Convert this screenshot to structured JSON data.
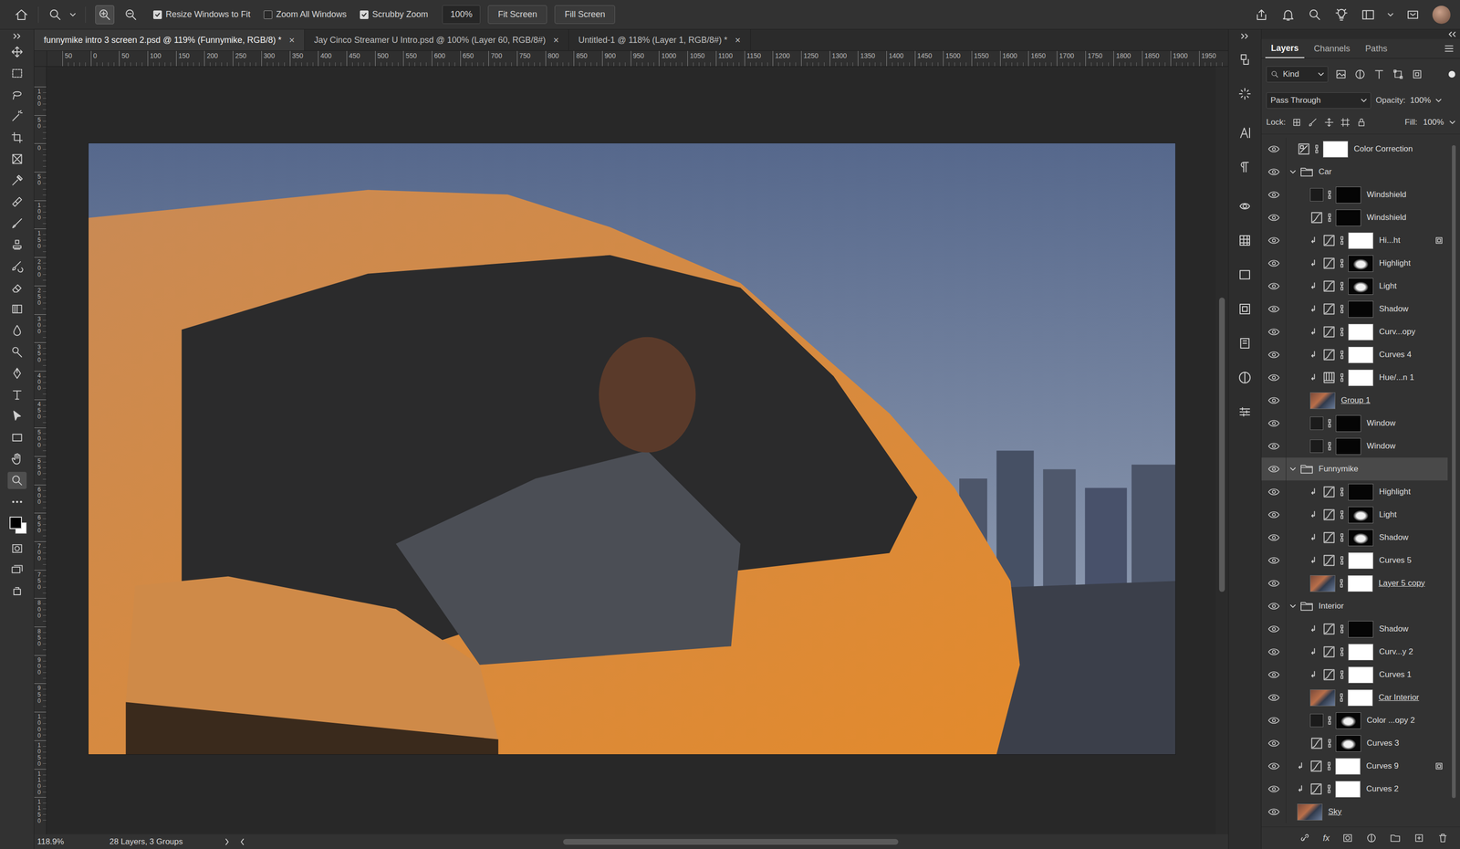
{
  "options_bar": {
    "checkboxes": [
      {
        "label": "Resize Windows to Fit",
        "checked": true
      },
      {
        "label": "Zoom All Windows",
        "checked": false
      },
      {
        "label": "Scrubby Zoom",
        "checked": true
      }
    ],
    "zoom_field": "100%",
    "buttons": [
      "Fit Screen",
      "Fill Screen"
    ]
  },
  "document_tabs": {
    "close": "×",
    "items": [
      {
        "label": "funnymike intro 3 screen 2.psd @ 119% (Funnymike, RGB/8) *",
        "selected": true
      },
      {
        "label": "Jay Cinco Streamer U Intro.psd @ 100% (Layer 60, RGB/8#)",
        "selected": false
      },
      {
        "label": "Untitled-1 @ 118% (Layer 1, RGB/8#) *",
        "selected": false
      }
    ]
  },
  "toolbar": {
    "tools": [
      {
        "kind": "move",
        "selected": false
      },
      {
        "kind": "marquee",
        "selected": false
      },
      {
        "kind": "lasso",
        "selected": false
      },
      {
        "kind": "wand",
        "selected": false
      },
      {
        "kind": "crop",
        "selected": false
      },
      {
        "kind": "frame",
        "selected": false
      },
      {
        "kind": "eyedropper",
        "selected": false
      },
      {
        "kind": "healing",
        "selected": false
      },
      {
        "kind": "brush",
        "selected": false
      },
      {
        "kind": "stamp",
        "selected": false
      },
      {
        "kind": "history",
        "selected": false
      },
      {
        "kind": "eraser",
        "selected": false
      },
      {
        "kind": "gradient",
        "selected": false
      },
      {
        "kind": "blur",
        "selected": false
      },
      {
        "kind": "dodge",
        "selected": false
      },
      {
        "kind": "pen",
        "selected": false
      },
      {
        "kind": "type",
        "selected": false
      },
      {
        "kind": "select",
        "selected": false
      },
      {
        "kind": "shape",
        "selected": false
      },
      {
        "kind": "hand",
        "selected": false
      },
      {
        "kind": "zoom",
        "selected": true
      },
      {
        "kind": "more",
        "selected": false
      },
      {
        "kind": "colors",
        "selected": false
      },
      {
        "kind": "quickmask",
        "selected": false
      },
      {
        "kind": "screen",
        "selected": false
      },
      {
        "kind": "extra",
        "selected": false
      }
    ]
  },
  "rulers": {
    "top": [
      "50",
      "0",
      "50",
      "100",
      "150",
      "200",
      "250",
      "300",
      "350",
      "400",
      "450",
      "500",
      "550",
      "600",
      "650",
      "700",
      "750",
      "800",
      "850",
      "900",
      "950",
      "1000",
      "1050",
      "1100",
      "1150",
      "1200",
      "1250",
      "1300",
      "1350",
      "1400",
      "1450",
      "1500",
      "1550",
      "1600",
      "1650",
      "1700",
      "1750",
      "1800",
      "1850",
      "1900",
      "1950"
    ],
    "left": [
      "100",
      "50",
      "0",
      "50",
      "100",
      "150",
      "200",
      "250",
      "300",
      "350",
      "400",
      "450",
      "500",
      "550",
      "600",
      "650",
      "700",
      "750",
      "800",
      "850",
      "900",
      "950",
      "1000",
      "1050",
      "1100",
      "1150"
    ]
  },
  "scrollbars": {
    "vertical": {
      "offset": 0.3,
      "size": 0.385
    },
    "horizontal": {
      "offset": 0.32,
      "size": 0.35
    },
    "layers": {
      "offset": 0.01,
      "size": 0.95
    }
  },
  "layers_panel": {
    "tabs": [
      {
        "label": "Layers",
        "selected": true
      },
      {
        "label": "Channels",
        "selected": false
      },
      {
        "label": "Paths",
        "selected": false
      }
    ],
    "filter": "Kind",
    "blend_mode": "Pass Through",
    "opacity_label": "Opacity:",
    "opacity": "100%",
    "lock_label": "Lock:",
    "fill_label": "Fill:",
    "fill": "100%",
    "footer_fx": "fx",
    "layers": [
      {
        "name": "Color Correction",
        "kind": "lookup",
        "indent": 0,
        "clip": false,
        "mask": "light",
        "clip_base": false,
        "badge": false,
        "visible": true,
        "selected": false
      },
      {
        "name": "Car",
        "kind": "group",
        "indent": 0,
        "clip": false,
        "mask": "none",
        "clip_base": false,
        "badge": false,
        "visible": true,
        "selected": false,
        "expanded": true
      },
      {
        "name": "Windshield",
        "kind": "fill",
        "indent": 1,
        "clip": false,
        "mask": "dark",
        "clip_base": false,
        "badge": false,
        "visible": true,
        "selected": false
      },
      {
        "name": "Windshield",
        "kind": "adjustment",
        "indent": 1,
        "clip": false,
        "mask": "dark",
        "clip_base": false,
        "badge": false,
        "visible": true,
        "selected": false
      },
      {
        "name": "Hi...ht",
        "kind": "adjustment",
        "indent": 1,
        "clip": true,
        "mask": "light",
        "clip_base": false,
        "badge": true,
        "visible": true,
        "selected": false
      },
      {
        "name": "Highlight",
        "kind": "adjustment",
        "indent": 1,
        "clip": true,
        "mask": "mixed",
        "clip_base": false,
        "badge": false,
        "visible": true,
        "selected": false
      },
      {
        "name": "Light",
        "kind": "adjustment",
        "indent": 1,
        "clip": true,
        "mask": "mixed",
        "clip_base": false,
        "badge": false,
        "visible": true,
        "selected": false
      },
      {
        "name": "Shadow",
        "kind": "adjustment",
        "indent": 1,
        "clip": true,
        "mask": "dark",
        "clip_base": false,
        "badge": false,
        "visible": true,
        "selected": false
      },
      {
        "name": "Curv...opy",
        "kind": "adjustment",
        "indent": 1,
        "clip": true,
        "mask": "light",
        "clip_base": false,
        "badge": false,
        "visible": true,
        "selected": false
      },
      {
        "name": "Curves 4",
        "kind": "adjustment",
        "indent": 1,
        "clip": true,
        "mask": "light",
        "clip_base": false,
        "badge": false,
        "visible": true,
        "selected": false
      },
      {
        "name": "Hue/...n 1",
        "kind": "hue",
        "indent": 1,
        "clip": true,
        "mask": "light",
        "clip_base": false,
        "badge": false,
        "visible": true,
        "selected": false
      },
      {
        "name": "Group 1",
        "kind": "pixel",
        "indent": 1,
        "clip": false,
        "mask": "none",
        "clip_base": true,
        "badge": false,
        "visible": true,
        "selected": false
      },
      {
        "name": "Window",
        "kind": "fill",
        "indent": 1,
        "clip": false,
        "mask": "dark",
        "clip_base": false,
        "badge": false,
        "visible": true,
        "selected": false
      },
      {
        "name": "Window",
        "kind": "fill",
        "indent": 1,
        "clip": false,
        "mask": "dark",
        "clip_base": false,
        "badge": false,
        "visible": true,
        "selected": false
      },
      {
        "name": "Funnymike",
        "kind": "group",
        "indent": 0,
        "clip": false,
        "mask": "none",
        "clip_base": false,
        "badge": false,
        "visible": true,
        "selected": true,
        "expanded": true
      },
      {
        "name": "Highlight",
        "kind": "adjustment",
        "indent": 1,
        "clip": true,
        "mask": "dark",
        "clip_base": false,
        "badge": false,
        "visible": true,
        "selected": false
      },
      {
        "name": "Light",
        "kind": "adjustment",
        "indent": 1,
        "clip": true,
        "mask": "mixed",
        "clip_base": false,
        "badge": false,
        "visible": true,
        "selected": false
      },
      {
        "name": "Shadow",
        "kind": "adjustment",
        "indent": 1,
        "clip": true,
        "mask": "mixed",
        "clip_base": false,
        "badge": false,
        "visible": true,
        "selected": false
      },
      {
        "name": "Curves 5",
        "kind": "adjustment",
        "indent": 1,
        "clip": true,
        "mask": "light",
        "clip_base": false,
        "badge": false,
        "visible": true,
        "selected": false
      },
      {
        "name": "Layer 5 copy",
        "kind": "pixel",
        "indent": 1,
        "clip": false,
        "mask": "light",
        "clip_base": true,
        "badge": false,
        "visible": true,
        "selected": false
      },
      {
        "name": "Interior",
        "kind": "group",
        "indent": 0,
        "clip": false,
        "mask": "none",
        "clip_base": false,
        "badge": false,
        "visible": true,
        "selected": false,
        "expanded": true
      },
      {
        "name": "Shadow",
        "kind": "adjustment",
        "indent": 1,
        "clip": true,
        "mask": "dark",
        "clip_base": false,
        "badge": false,
        "visible": true,
        "selected": false
      },
      {
        "name": "Curv...y 2",
        "kind": "adjustment",
        "indent": 1,
        "clip": true,
        "mask": "light",
        "clip_base": false,
        "badge": false,
        "visible": true,
        "selected": false
      },
      {
        "name": "Curves 1",
        "kind": "adjustment",
        "indent": 1,
        "clip": true,
        "mask": "light",
        "clip_base": false,
        "badge": false,
        "visible": true,
        "selected": false
      },
      {
        "name": "Car Interior",
        "kind": "pixel",
        "indent": 1,
        "clip": false,
        "mask": "light",
        "clip_base": true,
        "badge": false,
        "visible": true,
        "selected": false
      },
      {
        "name": "Color ...opy 2",
        "kind": "fill",
        "indent": 1,
        "clip": false,
        "mask": "mixed",
        "clip_base": false,
        "badge": false,
        "visible": true,
        "selected": false
      },
      {
        "name": "Curves 3",
        "kind": "adjustment",
        "indent": 1,
        "clip": false,
        "mask": "mixed",
        "clip_base": false,
        "badge": false,
        "visible": true,
        "selected": false
      },
      {
        "name": "Curves 9",
        "kind": "adjustment",
        "indent": 0,
        "clip": true,
        "mask": "light",
        "clip_base": false,
        "badge": true,
        "visible": true,
        "selected": false
      },
      {
        "name": "Curves 2",
        "kind": "adjustment",
        "indent": 0,
        "clip": true,
        "mask": "light",
        "clip_base": false,
        "badge": false,
        "visible": true,
        "selected": false
      },
      {
        "name": "Sky",
        "kind": "pixel",
        "indent": 0,
        "clip": false,
        "mask": "none",
        "clip_base": true,
        "badge": false,
        "visible": true,
        "selected": false
      }
    ]
  },
  "status_bar": {
    "zoom": "118.9%",
    "info": "28 Layers, 3 Groups"
  }
}
